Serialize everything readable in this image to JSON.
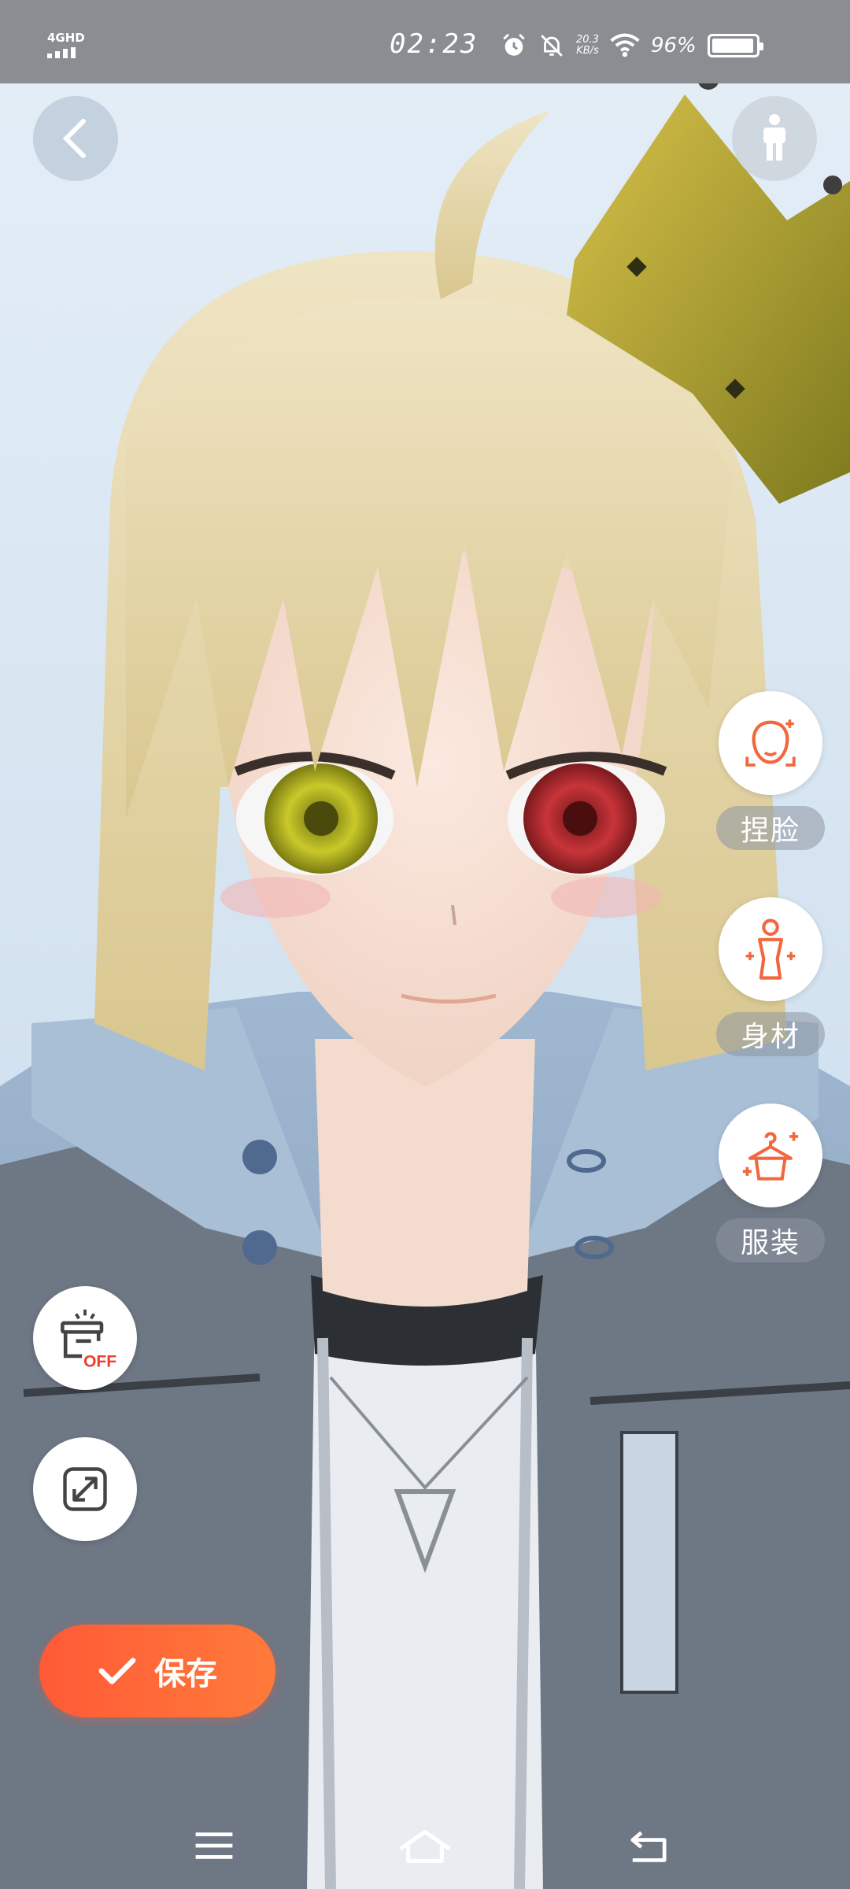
{
  "status_bar": {
    "network": "4GHD",
    "time": "02:23",
    "speed_value": "20.3",
    "speed_unit": "KB/s",
    "battery_percent": "96%",
    "icons": [
      "alarm-icon",
      "mute-bell-icon",
      "wifi-icon",
      "battery-icon"
    ]
  },
  "top_bar": {
    "back_icon": "chevron-left-icon",
    "pose_icon": "person-pose-icon"
  },
  "side_menu": [
    {
      "label": "捏脸",
      "icon": "face-icon"
    },
    {
      "label": "身材",
      "icon": "body-icon"
    },
    {
      "label": "服装",
      "icon": "hanger-clothes-icon"
    }
  ],
  "left_tools": {
    "background_toggle": {
      "badge": "OFF",
      "icon": "scene-off-icon"
    },
    "fullscreen_icon": "expand-icon"
  },
  "save_button": {
    "label": "保存",
    "icon": "check-icon"
  },
  "nav_bar": {
    "icons": [
      "menu-icon",
      "home-icon",
      "back-icon"
    ]
  },
  "colors": {
    "accent": "#ff5a36",
    "icon_orange": "#f2683e",
    "status_bar": "#8a8d91"
  }
}
